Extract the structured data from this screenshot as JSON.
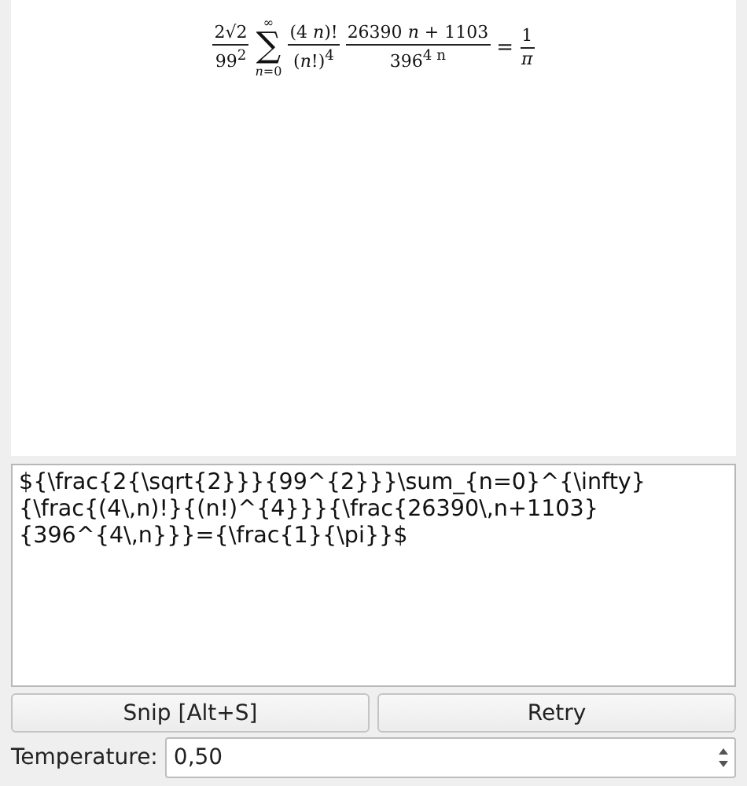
{
  "preview": {
    "formula": [
      {
        "kind": "fraction",
        "numerator": "2√2",
        "denominator": "99$^{2}$"
      },
      {
        "kind": "sum",
        "symbol": "∑",
        "top": "∞",
        "bottom": "*n*=0"
      },
      {
        "kind": "fraction",
        "numerator": "(4 *n*)!",
        "denominator": "(*n*!)$^{4}$"
      },
      {
        "kind": "fraction",
        "numerator": "26390 *n* + 1103",
        "denominator": "396$^{4 n}$"
      },
      {
        "kind": "operator",
        "text": "="
      },
      {
        "kind": "fraction",
        "numerator": "1",
        "denominator": "*π*"
      }
    ]
  },
  "editor": {
    "value": "${\\frac{2{\\sqrt{2}}}{99^{2}}}\\sum_{n=0}^{\\infty}{\\frac{(4\\,n)!}{(n!)^{4}}}{\\frac{26390\\,n+1103}{396^{4\\,n}}}={\\frac{1}{\\pi}}$"
  },
  "buttons": [
    "Snip [Alt+S]",
    "Retry"
  ],
  "temperature": {
    "label": "Temperature:",
    "value": "0,50"
  }
}
